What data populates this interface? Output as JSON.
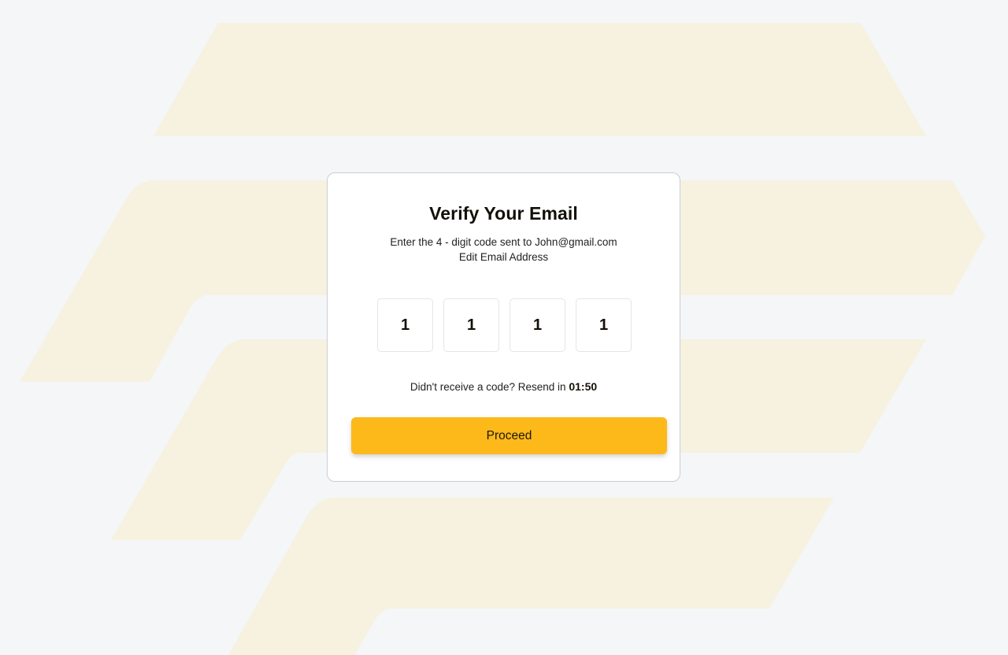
{
  "colors": {
    "page_background": "#f4f6f8",
    "background_shape": "#f7f1e0",
    "accent": "#fdb919",
    "card_border": "#c9ced4"
  },
  "verify": {
    "title": "Verify Your Email",
    "subtitle": "Enter the 4 - digit code sent to John@gmail.com",
    "edit_email_label": "Edit Email Address",
    "code_digits": [
      "1",
      "1",
      "1",
      "1"
    ],
    "resend_prefix": "Didn't receive a code? Resend in",
    "resend_timer": "01:50",
    "proceed_label": "Proceed"
  }
}
